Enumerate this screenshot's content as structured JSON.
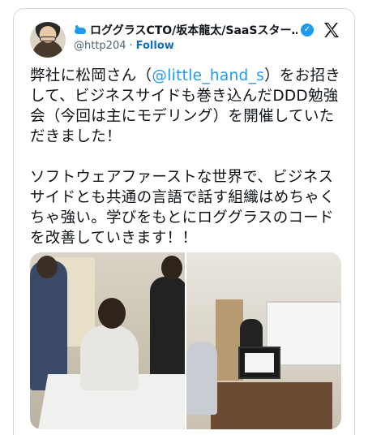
{
  "tweet": {
    "display_name": "ロググラスCTO/坂本龍太/SaaSスター…",
    "handle": "@http204",
    "separator": "·",
    "follow_label": "Follow",
    "body_before": "弊社に松岡さん（",
    "mention": "@little_hand_s",
    "body_after": "）をお招きして、ビジネスサイドも巻き込んだDDD勉強会（今回は主にモデリング）を開催していただきました！\n\nソフトウェアファーストな世界で、ビジネスサイドとも共通の言語で話す組織はめちゃくちゃ強い。学びをもとにロググラスのコードを改善していきます！！"
  },
  "icons": {
    "badge": "bird-icon",
    "verified": "verified-check-icon",
    "platform": "x-logo-icon"
  },
  "colors": {
    "accent": "#1d9bf0",
    "text": "#0f1419",
    "muted": "#536471",
    "border": "#cfd9de"
  }
}
